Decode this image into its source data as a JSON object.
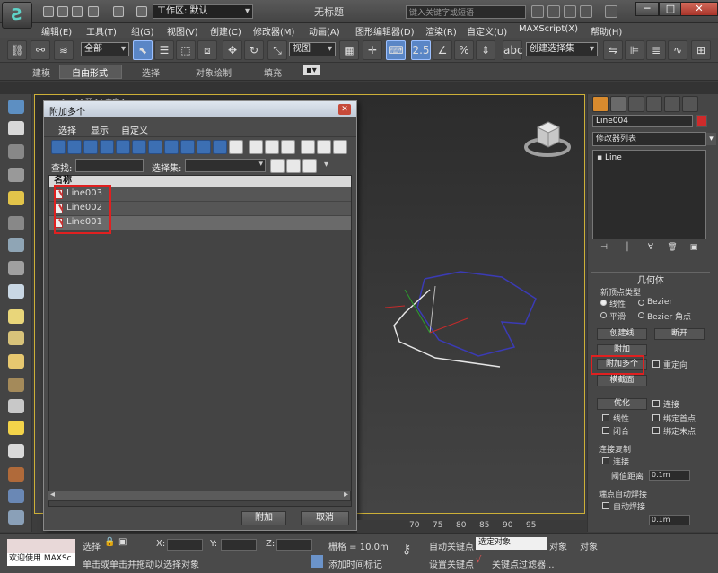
{
  "app": {
    "logo_glyph": "Ƨ",
    "window_title": "无标题",
    "workspace_combo": "工作区: 默认",
    "search_placeholder": "键入关键字或短语",
    "window_controls": {
      "minimize": "─",
      "maximize": "□",
      "close": "✕"
    }
  },
  "menu": [
    {
      "label": "编辑(E)"
    },
    {
      "label": "工具(T)"
    },
    {
      "label": "组(G)"
    },
    {
      "label": "视图(V)"
    },
    {
      "label": "创建(C)"
    },
    {
      "label": "修改器(M)"
    },
    {
      "label": "动画(A)"
    },
    {
      "label": "图形编辑器(D)"
    },
    {
      "label": "渲染(R)"
    },
    {
      "label": "自定义(U)"
    },
    {
      "label": "MAXScript(X)"
    },
    {
      "label": "帮助(H)"
    }
  ],
  "main_toolbar": {
    "selection_filter": "全部",
    "reference_coord": "视图",
    "named_selection": "创建选择集",
    "snap_label": "2.5",
    "angle_snap_label": "%"
  },
  "ribbon_tabs": [
    {
      "label": "建模"
    },
    {
      "label": "自由形式"
    },
    {
      "label": "选择"
    },
    {
      "label": "对象绘制"
    },
    {
      "label": "填充"
    }
  ],
  "viewport": {
    "label": "[ + ] [ 顶 ] [ 真实 ]"
  },
  "dialog": {
    "title": "附加多个",
    "close_glyph": "✕",
    "menu": [
      {
        "label": "选择"
      },
      {
        "label": "显示"
      },
      {
        "label": "自定义"
      }
    ],
    "find_label": "查找:",
    "find_value": "",
    "selection_set_label": "选择集:",
    "column_header": "名称",
    "items": [
      {
        "label": "Line003",
        "selected": false
      },
      {
        "label": "Line002",
        "selected": false
      },
      {
        "label": "Line001",
        "selected": true
      }
    ],
    "attach_button": "附加",
    "cancel_button": "取消"
  },
  "command_panel": {
    "object_name": "Line004",
    "object_color": "#cf2b2b",
    "modifier_list": "修改器列表",
    "stack_item": "Line",
    "rollout_title": "几何体",
    "new_vertex_type": "新顶点类型",
    "radio_linear": "线性",
    "radio_bezier": "Bezier",
    "radio_smooth": "平滑",
    "radio_bezier_corner": "Bezier 角点",
    "create_line": "创建线",
    "break": "断开",
    "attach": "附加",
    "attach_multiple": "附加多个",
    "reorient": "重定向",
    "cross_section": "横截面",
    "optimize": "优化",
    "connect": "连接",
    "linear": "线性",
    "bind_first": "绑定首点",
    "closed": "闭合",
    "bind_last": "绑定末点",
    "connect_copy": "连接复制",
    "connect_chk": "连接",
    "threshold_label": "阈值距离",
    "threshold_value": "0.1m",
    "end_point_weld": "端点自动焊接",
    "auto_weld": "自动焊接",
    "weld_threshold_value": "0.1m"
  },
  "timeline": {
    "ticks": [
      "70",
      "75",
      "80",
      "85",
      "90",
      "95"
    ]
  },
  "status": {
    "welcome": "欢迎使用 MAXSc",
    "prompt": "单击或单击并拖动以选择对象",
    "selection_label": "选择",
    "x_label": "X:",
    "y_label": "Y:",
    "z_label": "Z:",
    "grid_label": "栅格 = 10.0m",
    "auto_key": "自动关键点",
    "set_key": "设置关键点",
    "selected_object": "选定对象",
    "key_filters": "关键点过滤器...",
    "add_time_tag": "添加时间标记",
    "object_label": "对象"
  }
}
